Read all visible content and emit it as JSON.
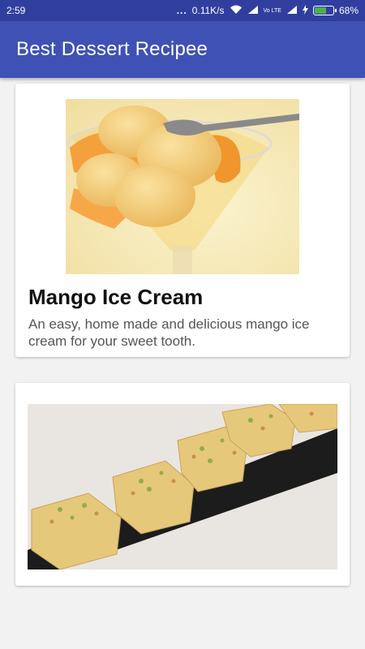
{
  "status_bar": {
    "time": "2:59",
    "dots": "...",
    "network_speed": "0.11K/s",
    "volte_label": "Vo LTE",
    "battery_percent": "68%",
    "battery_level": 0.68
  },
  "app_bar": {
    "title": "Best Dessert Recipee"
  },
  "recipes": [
    {
      "title": "Mango Ice Cream",
      "description": "An easy, home made and delicious mango ice cream for your sweet tooth.",
      "image_icon": "ice-cream-photo"
    },
    {
      "title": "",
      "description": "",
      "image_icon": "burfi-photo"
    }
  ],
  "colors": {
    "status_bar": "#303f9f",
    "app_bar": "#3f51b5",
    "background": "#f2f2f2",
    "battery": "#4caf50"
  }
}
